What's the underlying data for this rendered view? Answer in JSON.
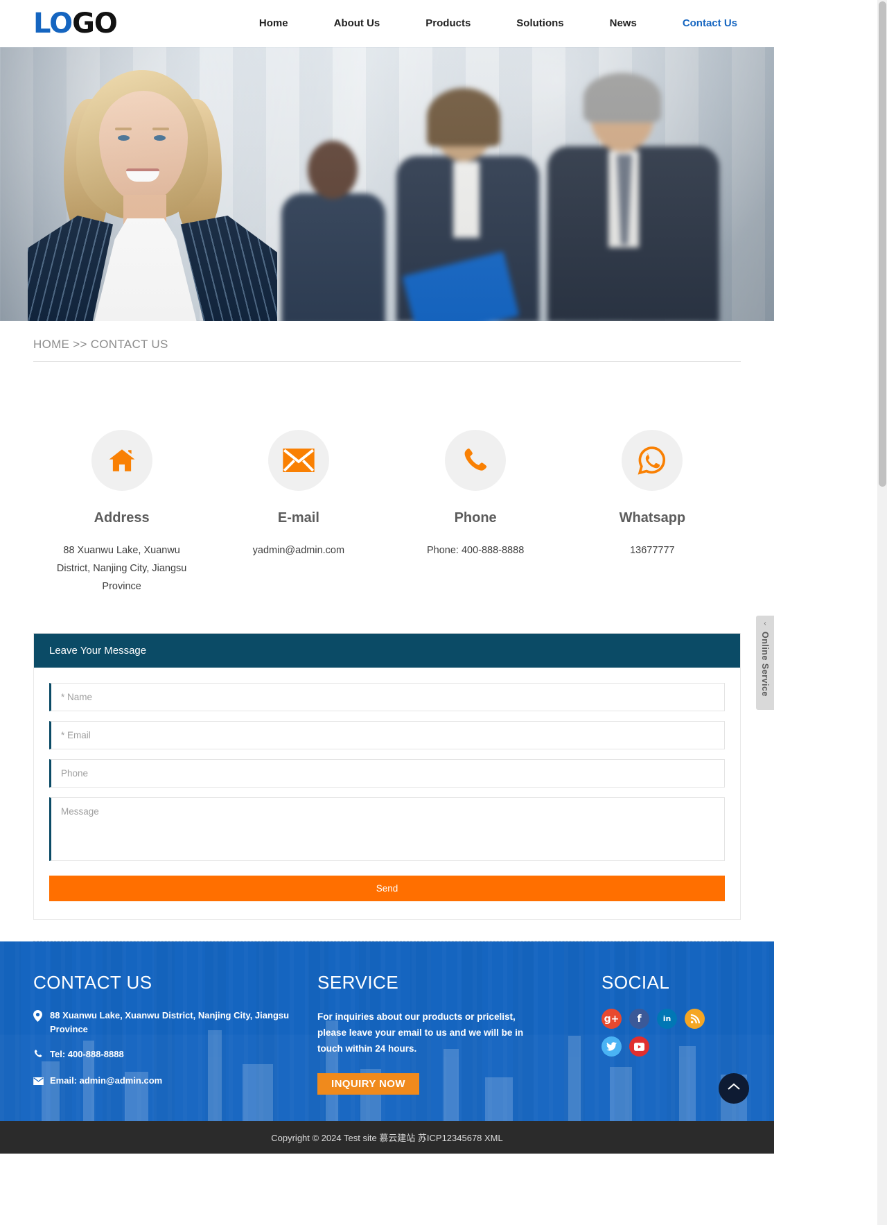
{
  "header": {
    "logo": {
      "part1": "LO",
      "part2": "GO"
    },
    "nav": [
      {
        "label": "Home",
        "active": false
      },
      {
        "label": "About Us",
        "active": false
      },
      {
        "label": "Products",
        "active": false
      },
      {
        "label": "Solutions",
        "active": false
      },
      {
        "label": "News",
        "active": false
      },
      {
        "label": "Contact Us",
        "active": true
      }
    ],
    "accent_color": "#1565C0"
  },
  "breadcrumb": {
    "home": "HOME",
    "separator": ">>",
    "current": "CONTACT US",
    "full": "HOME >> CONTACT US"
  },
  "contact_cards": [
    {
      "icon": "home-icon",
      "title": "Address",
      "text": "88 Xuanwu Lake, Xuanwu District, Nanjing City, Jiangsu Province"
    },
    {
      "icon": "envelope-icon",
      "title": "E-mail",
      "text": "yadmin@admin.com"
    },
    {
      "icon": "phone-icon",
      "title": "Phone",
      "text": "Phone: 400-888-8888"
    },
    {
      "icon": "whatsapp-icon",
      "title": "Whatsapp",
      "text": "13677777"
    }
  ],
  "form": {
    "title": "Leave Your Message",
    "header_color": "#0b4b66",
    "fields": {
      "name_placeholder": "* Name",
      "email_placeholder": "* Email",
      "phone_placeholder": "Phone",
      "message_placeholder": "Message"
    },
    "send_label": "Send",
    "send_color": "#ff6f00"
  },
  "footer": {
    "background_color": "#1565C0",
    "contact": {
      "heading": "CONTACT US",
      "address": "88 Xuanwu Lake, Xuanwu District, Nanjing City, Jiangsu Province",
      "tel": "Tel: 400-888-8888",
      "email": "Email: admin@admin.com"
    },
    "service": {
      "heading": "SERVICE",
      "description": "For inquiries about our products or pricelist, please leave your email to us and we will be in touch within 24 hours.",
      "button_label": "INQUIRY NOW",
      "button_color": "#f08a1c"
    },
    "social": {
      "heading": "SOCIAL",
      "items": [
        {
          "name": "google-plus-icon",
          "glyph": "g+",
          "color": "#e8492f"
        },
        {
          "name": "facebook-icon",
          "glyph": "f",
          "color": "#3b5998"
        },
        {
          "name": "linkedin-icon",
          "glyph": "in",
          "color": "#0077b5"
        },
        {
          "name": "rss-icon",
          "glyph": "◔",
          "color": "#f5a623"
        },
        {
          "name": "twitter-icon",
          "glyph": "t",
          "color": "#4ab3f4"
        },
        {
          "name": "youtube-icon",
          "glyph": "▶",
          "color": "#e02f2f"
        }
      ]
    }
  },
  "copyright": "Copyright © 2024 Test site 慕云建站 苏ICP12345678 XML",
  "floating": {
    "online_service_label": "Online Service",
    "online_service_arrow": "‹",
    "go_top_label": "back-to-top"
  }
}
